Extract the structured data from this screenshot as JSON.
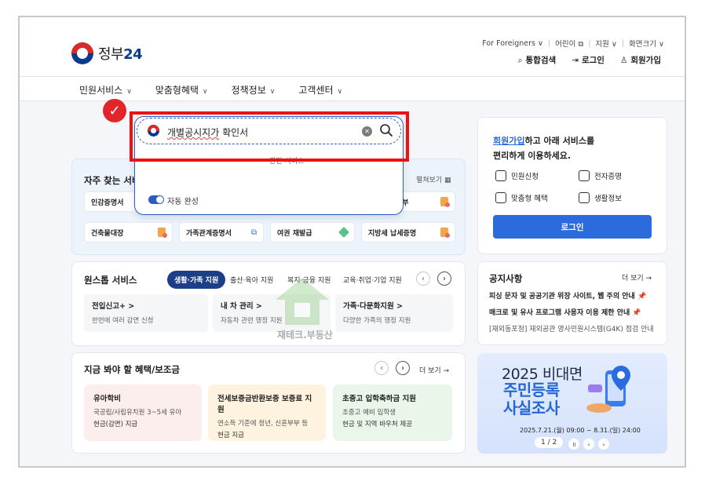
{
  "header": {
    "logo_text": "정부",
    "logo_num": "24",
    "util_links": [
      "For Foreigners ∨",
      "어린이 ⧉",
      "지원 ∨",
      "화면크기 ∨"
    ],
    "top_nav": [
      {
        "icon": "⌕",
        "label": "통합검색"
      },
      {
        "icon": "⇥",
        "label": "로그인"
      },
      {
        "icon": "♙",
        "label": "회원가입"
      }
    ],
    "main_nav": [
      "민원서비스",
      "맞춤형혜택",
      "정책정보",
      "고객센터"
    ]
  },
  "search": {
    "value": "개별공시지가 확인서",
    "value_plain": "개별공시지가",
    "value_rest": " 확인서",
    "related_label": "관련 서비스",
    "auto_complete": "자동 완성",
    "clear": "✕"
  },
  "favorites": {
    "title": "자주 찾는 서비",
    "more": "펼쳐보기 ▦",
    "chips": [
      {
        "label": "인감증명서"
      },
      {
        "label": "원부"
      },
      {
        "label": "건축물대장"
      },
      {
        "label": "가족관계증명서"
      },
      {
        "label": "여권 재발급"
      },
      {
        "label": "지방세 납세증명"
      }
    ]
  },
  "onestop": {
    "title": "원스톱 서비스",
    "tabs": [
      "생활·가족 지원",
      "출산·육아 지원",
      "복지·금융 지원",
      "교육·취업·기업 지원"
    ],
    "items": [
      {
        "title": "전입신고+ >",
        "desc": "한번에 여러 감면 신청"
      },
      {
        "title": "내 차 관리 >",
        "desc": "자동차 관련 행정 지원"
      },
      {
        "title": "가족·다문화지원 >",
        "desc": "다양한 가족의 행정 지원"
      }
    ]
  },
  "benefits": {
    "title": "지금 봐야 할 혜택/보조금",
    "more": "더 보기 →",
    "items": [
      {
        "title": "유아학비",
        "desc": "국공립/사립유치원 3~5세 유아",
        "foot": "현금(감면) 지급"
      },
      {
        "title": "전세보증금반환보증 보증료 지원",
        "desc": "연소득 기준에 청년, 신혼부부 등",
        "foot": "현금 지급"
      },
      {
        "title": "초중고 입학축하금 지원",
        "desc": "초중고 예비 입학생",
        "foot": "현금 및 지역 바우처 제공"
      }
    ]
  },
  "account": {
    "line1_link": "회원가입",
    "line1_rest": "하고 아래 서비스를",
    "line2": "편리하게 이용하세요.",
    "quick": [
      "민원신청",
      "전자증명",
      "맞춤형 혜택",
      "생활정보"
    ],
    "login": "로그인"
  },
  "notice": {
    "title": "공지사항",
    "more": "더 보기 →",
    "items": [
      "피싱 문자 및 공공기관 위장 사이트, 웹 주의 안내",
      "매크로 및 유사 프로그램 사용자 이용 제한 안내",
      "[재외동포청] 재외공관 영사민원시스템(G4K) 점검 안내"
    ]
  },
  "banner": {
    "line1": "2025 비대면",
    "line2": "주민등록",
    "line3": "사실조사",
    "date": "2025.7.21.(월) 09:00 ~ 8.31.(일) 24:00",
    "pager": "1 / 2"
  },
  "watermark": "재테크.부동산",
  "colors": {
    "brand_blue": "#0b3a8c",
    "accent": "#2b6bdc",
    "highlight_red": "#ee1111",
    "nav_dark": "#1d3f8a"
  }
}
